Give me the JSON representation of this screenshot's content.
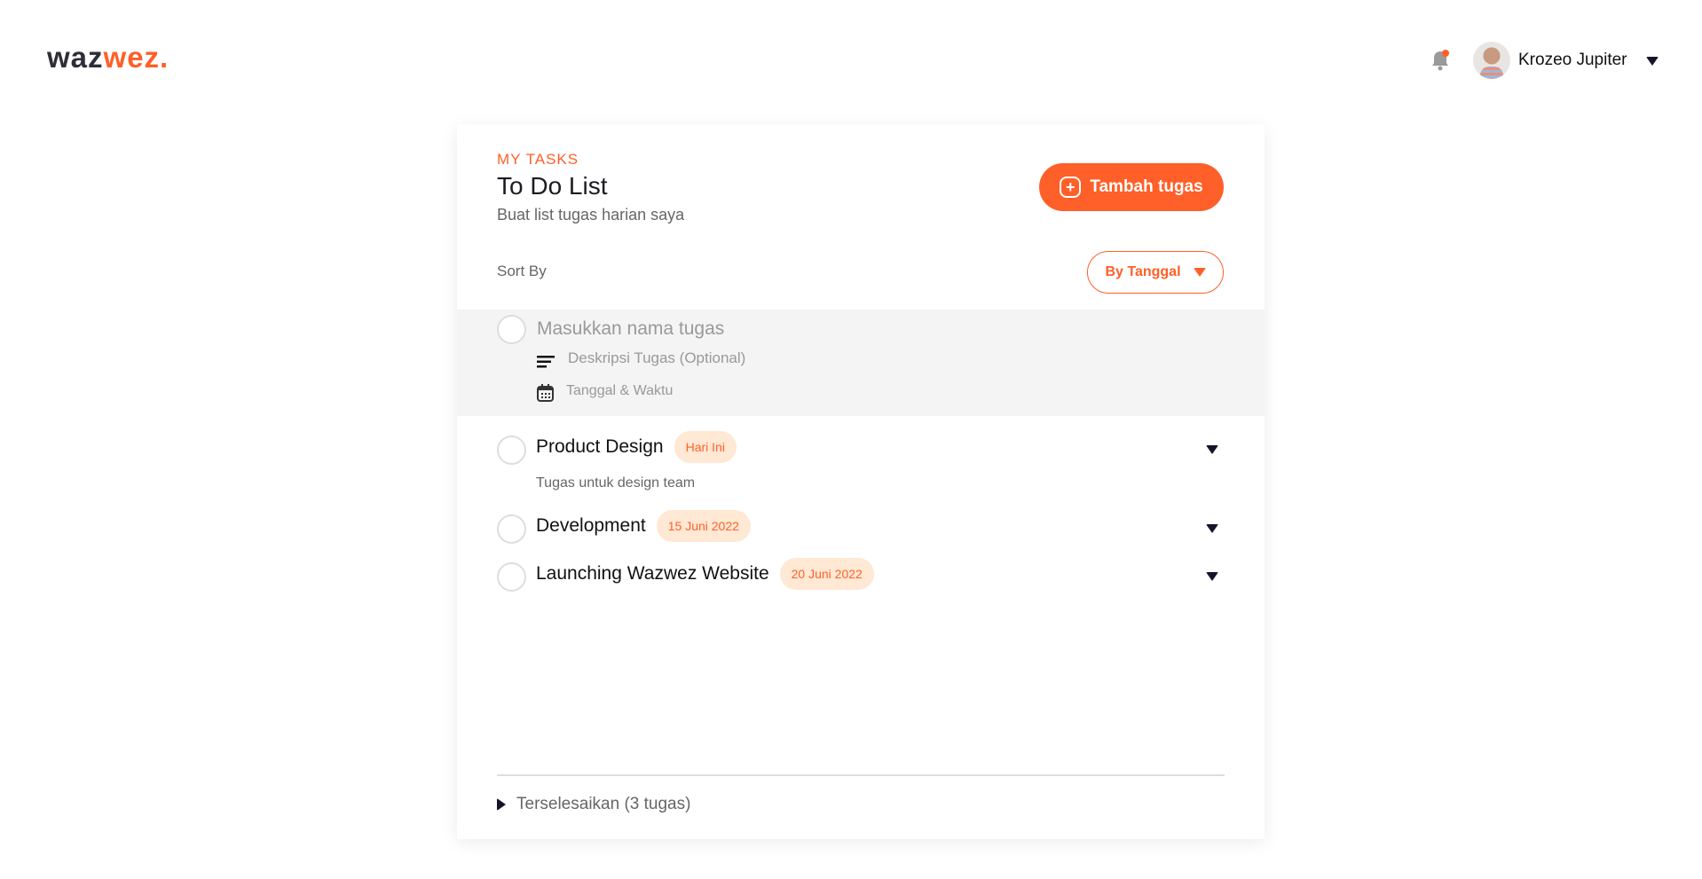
{
  "header": {
    "logo_part1": "waz",
    "logo_part2": "wez.",
    "user_name": "Krozeo Jupiter"
  },
  "card": {
    "kicker": "MY TASKS",
    "title": "To Do List",
    "subtitle": "Buat list tugas harian saya",
    "add_button": "Tambah tugas",
    "sort_label": "Sort By",
    "sort_value": "By Tanggal"
  },
  "new_task": {
    "name_placeholder": "Masukkan nama tugas",
    "desc_placeholder": "Deskripsi Tugas (Optional)",
    "date_placeholder": "Tanggal & Waktu"
  },
  "tasks": [
    {
      "name": "Product Design",
      "badge": "Hari Ini",
      "description": "Tugas untuk design team"
    },
    {
      "name": "Development",
      "badge": "15 Juni 2022"
    },
    {
      "name": "Launching Wazwez Website",
      "badge": "20 Juni 2022"
    }
  ],
  "completed": {
    "label": "Terselesaikan (3 tugas)"
  },
  "colors": {
    "accent": "#ff5f28",
    "badge_bg": "#ffe8d4"
  }
}
